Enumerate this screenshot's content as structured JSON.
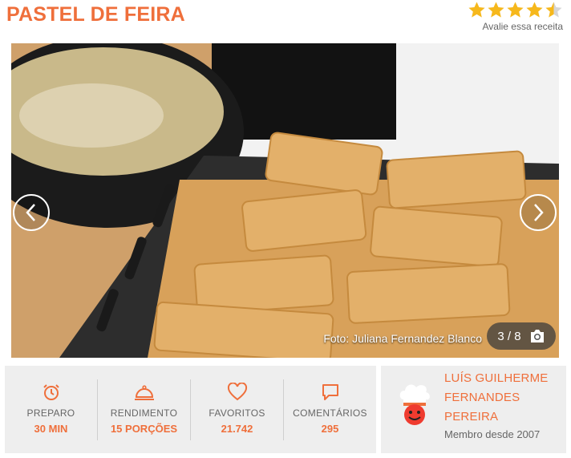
{
  "recipe": {
    "title": "PASTEL DE FEIRA"
  },
  "rating": {
    "stars": 4.5,
    "max": 5,
    "label": "Avalie essa receita",
    "star_color": "#f6b81c"
  },
  "gallery": {
    "caption": "Foto: Juliana Fernandez Blanco",
    "counter": "3 / 8",
    "current": 3,
    "total": 8
  },
  "stats": [
    {
      "icon": "alarm-clock-icon",
      "label": "PREPARO",
      "value": "30 MIN"
    },
    {
      "icon": "cloche-icon",
      "label": "RENDIMENTO",
      "value": "15 PORÇÕES"
    },
    {
      "icon": "heart-icon",
      "label": "FAVORITOS",
      "value": "21.742"
    },
    {
      "icon": "comment-icon",
      "label": "COMENTÁRIOS",
      "value": "295"
    }
  ],
  "author": {
    "name": "LUÍS GUILHERME FERNANDES PEREIRA",
    "since": "Membro desde 2007",
    "avatar": "chef-avatar-icon"
  },
  "colors": {
    "accent": "#ef6f3b",
    "panel": "#eeeeee",
    "muted": "#666666"
  }
}
